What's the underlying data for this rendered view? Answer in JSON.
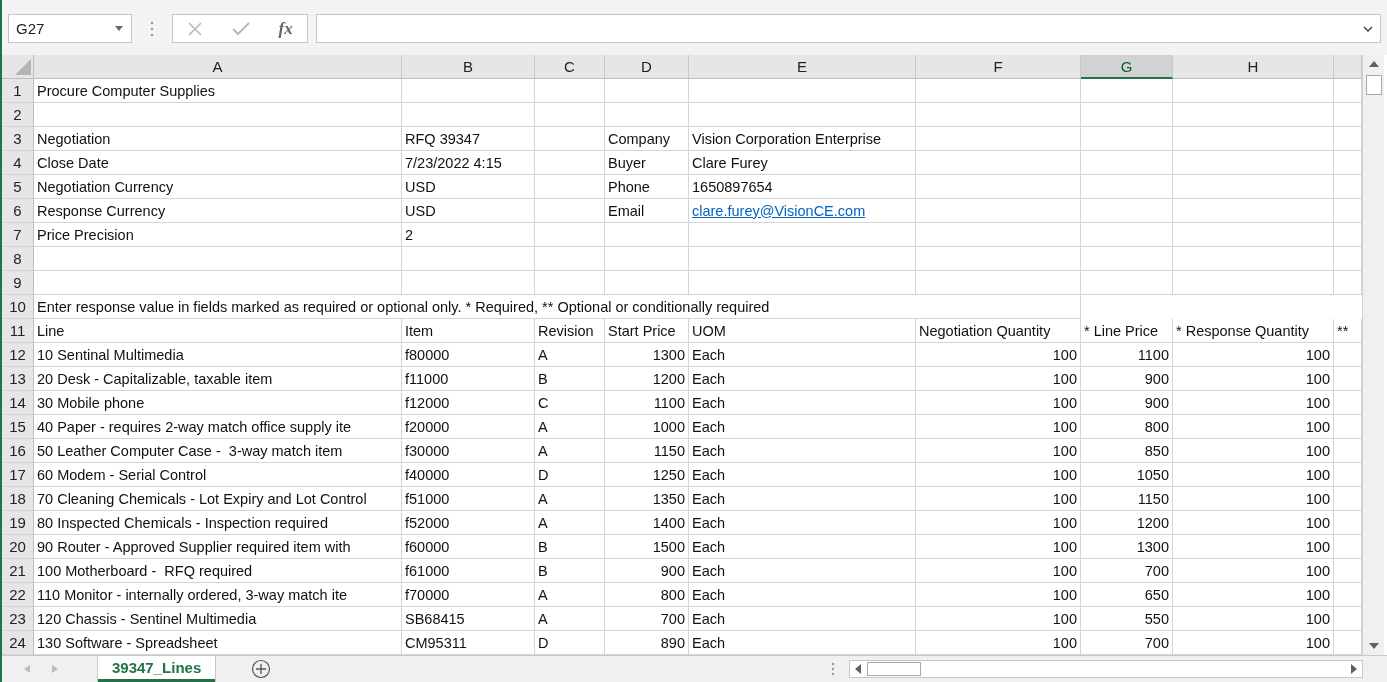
{
  "formula_bar": {
    "name_box": "G27",
    "function_label": "fx"
  },
  "columns": [
    {
      "letter": "A",
      "selected": false
    },
    {
      "letter": "B",
      "selected": false
    },
    {
      "letter": "C",
      "selected": false
    },
    {
      "letter": "D",
      "selected": false
    },
    {
      "letter": "E",
      "selected": false
    },
    {
      "letter": "F",
      "selected": false
    },
    {
      "letter": "G",
      "selected": true
    },
    {
      "letter": "H",
      "selected": false
    }
  ],
  "rows": [
    {
      "number": "1",
      "kind": "info",
      "cells": {
        "A": "Procure Computer Supplies"
      }
    },
    {
      "number": "2",
      "kind": "blank",
      "cells": {}
    },
    {
      "number": "3",
      "kind": "info",
      "cells": {
        "A": "Negotiation",
        "B": "RFQ 39347",
        "D": "Company",
        "E": "Vision Corporation Enterprise"
      }
    },
    {
      "number": "4",
      "kind": "info",
      "cells": {
        "A": "Close Date",
        "B": "7/23/2022 4:15",
        "D": "Buyer",
        "E": "Clare Furey"
      }
    },
    {
      "number": "5",
      "kind": "info",
      "cells": {
        "A": "Negotiation Currency",
        "B": "USD",
        "D": "Phone",
        "E": "1650897654"
      }
    },
    {
      "number": "6",
      "kind": "info",
      "cells": {
        "A": "Response Currency",
        "B": "USD",
        "D": "Email",
        "E": {
          "text": "clare.furey@VisionCE.com",
          "link": true
        }
      }
    },
    {
      "number": "7",
      "kind": "info",
      "cells": {
        "A": "Price Precision",
        "B": "2"
      }
    },
    {
      "number": "8",
      "kind": "blank",
      "cells": {}
    },
    {
      "number": "9",
      "kind": "blank",
      "cells": {}
    },
    {
      "number": "10",
      "kind": "note",
      "cells": {
        "A": "Enter response value in fields marked as required or optional only. * Required, ** Optional or conditionally required"
      }
    },
    {
      "number": "11",
      "kind": "header",
      "cells": {
        "A": "Line",
        "B": "Item",
        "C": "Revision",
        "D": "Start Price",
        "E": "UOM",
        "F": "Negotiation Quantity",
        "G": "* Line Price",
        "H": "* Response Quantity",
        "I": "**"
      }
    },
    {
      "number": "12",
      "kind": "line",
      "cells": {
        "A": "10 Sentinal Multimedia",
        "B": "f80000",
        "C": "A",
        "D": "1300",
        "E": "Each",
        "F": "100",
        "G": "1100",
        "H": "100"
      }
    },
    {
      "number": "13",
      "kind": "line",
      "cells": {
        "A": "20 Desk - Capitalizable, taxable item",
        "B": "f11000",
        "C": "B",
        "D": "1200",
        "E": "Each",
        "F": "100",
        "G": "900",
        "H": "100"
      }
    },
    {
      "number": "14",
      "kind": "line",
      "cells": {
        "A": "30 Mobile phone",
        "B": "f12000",
        "C": "C",
        "D": "1100",
        "E": "Each",
        "F": "100",
        "G": "900",
        "H": "100"
      }
    },
    {
      "number": "15",
      "kind": "line",
      "cells": {
        "A": "40 Paper - requires 2-way match office supply ite",
        "B": "f20000",
        "C": "A",
        "D": "1000",
        "E": "Each",
        "F": "100",
        "G": "800",
        "H": "100"
      }
    },
    {
      "number": "16",
      "kind": "line",
      "cells": {
        "A": "50 Leather Computer Case -  3-way match item",
        "B": "f30000",
        "C": "A",
        "D": "1150",
        "E": "Each",
        "F": "100",
        "G": "850",
        "H": "100"
      }
    },
    {
      "number": "17",
      "kind": "line",
      "cells": {
        "A": "60 Modem - Serial Control",
        "B": "f40000",
        "C": "D",
        "D": "1250",
        "E": "Each",
        "F": "100",
        "G": "1050",
        "H": "100"
      }
    },
    {
      "number": "18",
      "kind": "line",
      "cells": {
        "A": "70 Cleaning Chemicals - Lot Expiry and Lot Control",
        "B": "f51000",
        "C": "A",
        "D": "1350",
        "E": "Each",
        "F": "100",
        "G": "1150",
        "H": "100"
      }
    },
    {
      "number": "19",
      "kind": "line",
      "cells": {
        "A": "80 Inspected Chemicals - Inspection required",
        "B": "f52000",
        "C": "A",
        "D": "1400",
        "E": "Each",
        "F": "100",
        "G": "1200",
        "H": "100"
      }
    },
    {
      "number": "20",
      "kind": "line",
      "cells": {
        "A": "90 Router - Approved Supplier required item with",
        "B": "f60000",
        "C": "B",
        "D": "1500",
        "E": "Each",
        "F": "100",
        "G": "1300",
        "H": "100"
      }
    },
    {
      "number": "21",
      "kind": "line",
      "cells": {
        "A": "100 Motherboard -  RFQ required",
        "B": "f61000",
        "C": "B",
        "D": "900",
        "E": "Each",
        "F": "100",
        "G": "700",
        "H": "100"
      }
    },
    {
      "number": "22",
      "kind": "line",
      "cells": {
        "A": "110 Monitor - internally ordered, 3-way match ite",
        "B": "f70000",
        "C": "A",
        "D": "800",
        "E": "Each",
        "F": "100",
        "G": "650",
        "H": "100"
      }
    },
    {
      "number": "23",
      "kind": "line",
      "cells": {
        "A": "120 Chassis - Sentinel Multimedia",
        "B": "SB68415",
        "C": "A",
        "D": "700",
        "E": "Each",
        "F": "100",
        "G": "550",
        "H": "100"
      }
    },
    {
      "number": "24",
      "kind": "line",
      "cells": {
        "A": "130 Software - Spreadsheet",
        "B": "CM95311",
        "C": "D",
        "D": "890",
        "E": "Each",
        "F": "100",
        "G": "700",
        "H": "100"
      }
    }
  ],
  "sheet_tabs": [
    {
      "label": "39347_Lines",
      "selected": true
    }
  ]
}
